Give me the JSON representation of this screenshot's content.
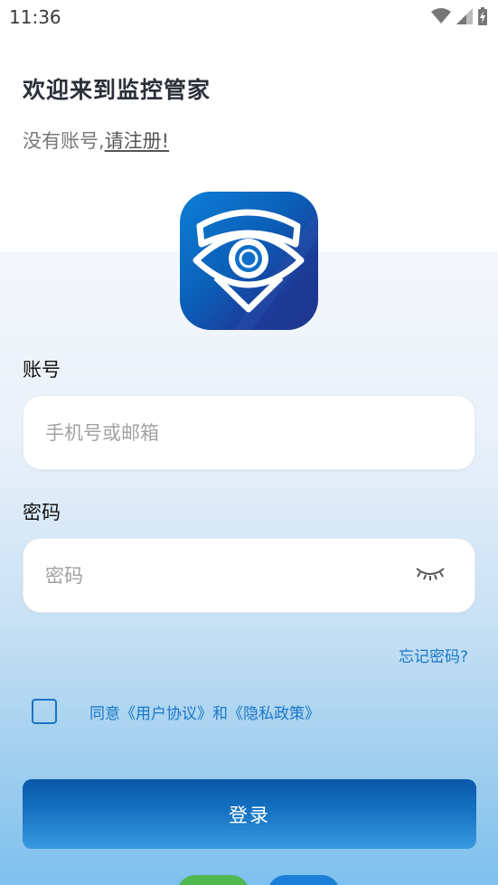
{
  "status_bar": {
    "time": "11:36",
    "icons": [
      "wifi-icon",
      "signal-icon",
      "battery-charging-icon"
    ]
  },
  "header": {
    "welcome": "欢迎来到监控管家",
    "no_account": "没有账号,",
    "register_link": "请注册!"
  },
  "logo": {
    "icon": "eye-shield-logo",
    "colors": [
      "#0d7fd6",
      "#2a2f8f"
    ]
  },
  "account": {
    "label": "账号",
    "placeholder": "手机号或邮箱",
    "value": ""
  },
  "password": {
    "label": "密码",
    "placeholder": "密码",
    "value": "",
    "toggle_icon": "eye-closed-icon"
  },
  "forgot": "忘记密码?",
  "agreement": {
    "checked": false,
    "text": "同意《用户协议》和《隐私政策》"
  },
  "login_button": "登录",
  "social_icons": [
    "wechat-icon",
    "qq-icon"
  ],
  "colors": {
    "accent": "#1a78c8",
    "button_top": "#0a57a8",
    "button_bottom": "#3a9ae0"
  }
}
